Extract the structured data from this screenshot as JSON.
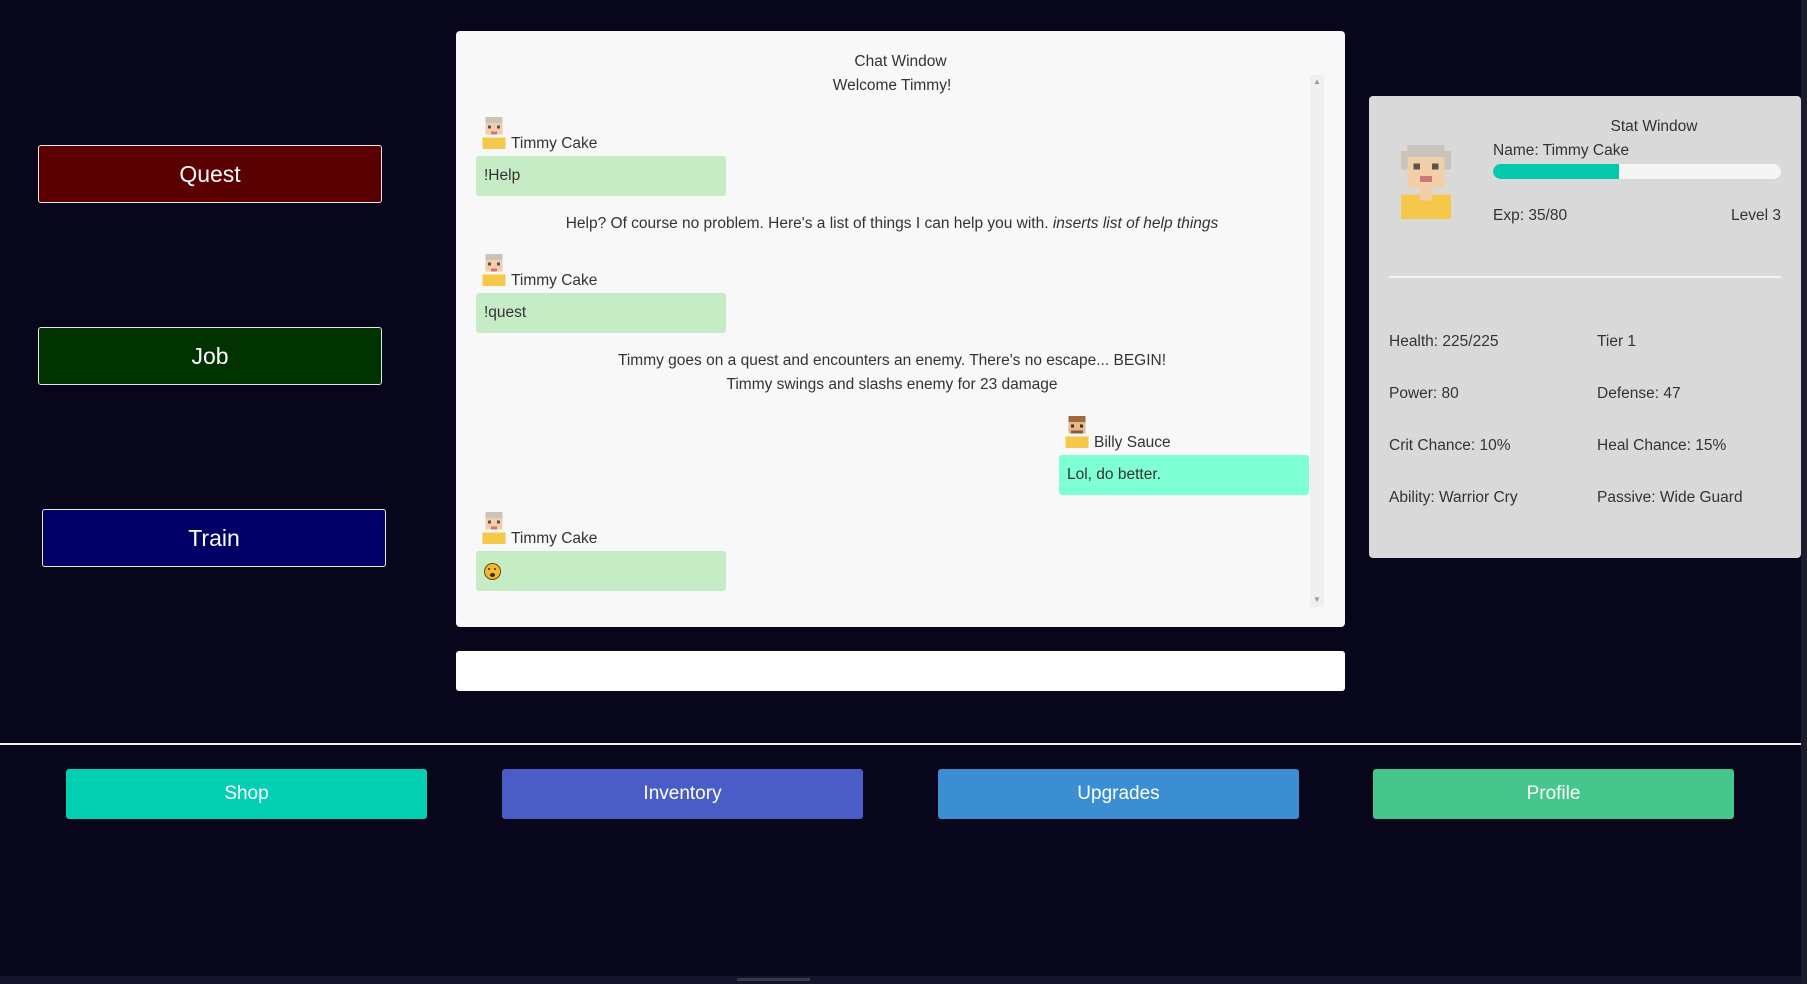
{
  "sidebar": {
    "quest": {
      "label": "Quest",
      "color": "#5a0000"
    },
    "job": {
      "label": "Job",
      "color": "#003300"
    },
    "train": {
      "label": "Train",
      "color": "#000066"
    }
  },
  "chat": {
    "title": "Chat Window",
    "welcome": "Welcome Timmy!",
    "messages": [
      {
        "user": "Timmy Cake",
        "text": "!Help"
      },
      {
        "system": "Help? Of course no problem. Here's a list of things I can help you with.",
        "system_em": "inserts list of help things"
      },
      {
        "user": "Timmy Cake",
        "text": "!quest"
      },
      {
        "system": "Timmy goes on a quest and encounters an enemy. There's no escape... BEGIN!",
        "system2": "Timmy swings and slashs enemy for 23 damage"
      },
      {
        "user": "Billy Sauce",
        "text": "Lol, do better."
      },
      {
        "user": "Timmy Cake",
        "text": "😮",
        "icon": "surprised-face-emoji"
      }
    ],
    "input_value": ""
  },
  "stats": {
    "title": "Stat Window",
    "name_line": "Name: Timmy Cake",
    "exp_fraction": 0.4375,
    "exp_text": "Exp: 35/80",
    "level_text": "Level 3",
    "health": "Health: 225/225",
    "tier": "Tier 1",
    "power": "Power: 80",
    "defense": "Defense: 47",
    "crit": "Crit Chance: 10%",
    "heal": "Heal Chance: 15%",
    "ability": "Ability: Warrior Cry",
    "passive": "Passive: Wide Guard"
  },
  "nav": {
    "shop": {
      "label": "Shop",
      "color": "#03cfb3"
    },
    "inventory": {
      "label": "Inventory",
      "color": "#4a5dc7"
    },
    "upgrades": {
      "label": "Upgrades",
      "color": "#3b8ed2"
    },
    "profile": {
      "label": "Profile",
      "color": "#45c68a"
    }
  }
}
